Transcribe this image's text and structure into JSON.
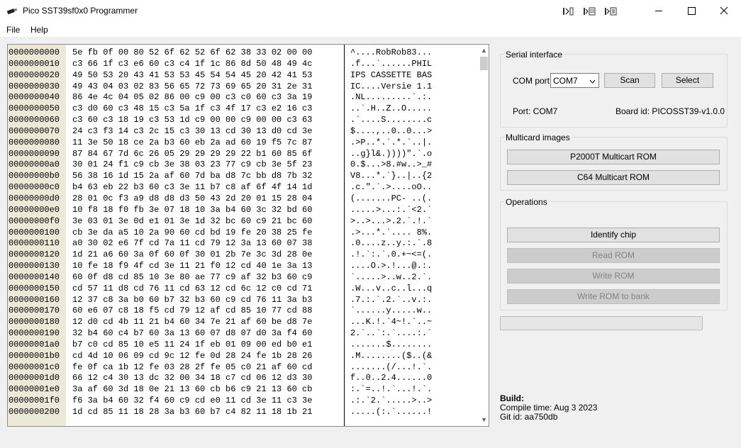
{
  "window": {
    "title": "Pico SST39sf0x0 Programmer",
    "app_icon": "usb-stick-icon",
    "toolbar_icons": [
      "dock-left-icon",
      "dock-image-icon",
      "dock-list-icon"
    ],
    "controls": {
      "minimize": "minimize-icon",
      "maximize": "maximize-icon",
      "close": "close-icon"
    }
  },
  "menu": {
    "file": "File",
    "help": "Help"
  },
  "hex": {
    "rows": [
      {
        "addr": "0000000000",
        "hex": "5e fb 0f 00 80 52 6f 62 52 6f 62 38 33 02 00 00",
        "ascii": "^....RobRob83..."
      },
      {
        "addr": "0000000010",
        "hex": "c3 66 1f c3 e6 60 c3 c4 1f 1c 86 8d 50 48 49 4c",
        "ascii": ".f...`......PHIL"
      },
      {
        "addr": "0000000020",
        "hex": "49 50 53 20 43 41 53 53 45 54 54 45 20 42 41 53",
        "ascii": "IPS CASSETTE BAS"
      },
      {
        "addr": "0000000030",
        "hex": "49 43 04 03 02 83 56 65 72 73 69 65 20 31 2e 31",
        "ascii": "IC....Versie 1.1"
      },
      {
        "addr": "0000000040",
        "hex": "86 4e 4c 04 05 02 86 00 c9 00 c3 c0 60 c3 3a 19",
        "ascii": ".NL.........`.:."
      },
      {
        "addr": "0000000050",
        "hex": "c3 d0 60 c3 48 15 c3 5a 1f c3 4f 17 c3 e2 16 c3",
        "ascii": "..`.H..Z..O....."
      },
      {
        "addr": "0000000060",
        "hex": "c3 60 c3 18 19 c3 53 1d c9 00 00 c9 00 00 c3 63",
        "ascii": ".`....S........c"
      },
      {
        "addr": "0000000070",
        "hex": "24 c3 f3 14 c3 2c 15 c3 30 13 cd 30 13 d0 cd 3e",
        "ascii": "$....,..0..0...>"
      },
      {
        "addr": "0000000080",
        "hex": "11 3e 50 18 ce 2a b3 60 eb 2a ad 60 19 f5 7c 87",
        "ascii": ".>P..*.`.*.`..|."
      },
      {
        "addr": "0000000090",
        "hex": "87 84 67 7d 6c 26 05 29 29 29 29 22 b1 60 85 6f",
        "ascii": "..g}l&.))))\".`.o"
      },
      {
        "addr": "00000000a0",
        "hex": "30 01 24 f1 c9 cb 3e 38 03 23 77 c9 cb 3e 5f 23",
        "ascii": "0.$...>8.#w..>_#"
      },
      {
        "addr": "00000000b0",
        "hex": "56 38 16 1d 15 2a af 60 7d ba d8 7c bb d8 7b 32",
        "ascii": "V8...*.`}..|..{2"
      },
      {
        "addr": "00000000c0",
        "hex": "b4 63 eb 22 b3 60 c3 3e 11 b7 c8 af 6f 4f 14 1d",
        "ascii": ".c.\".`.>....oO.."
      },
      {
        "addr": "00000000d0",
        "hex": "28 01 0c f3 a9 d8 d8 d3 50 43 2d 20 01 15 28 04",
        "ascii": "(.......PC- ..(."
      },
      {
        "addr": "00000000e0",
        "hex": "10 f8 18 f0 fb 3e 07 18 10 3a b4 60 3c 32 bd 60",
        "ascii": ".....>...:.`<2.`"
      },
      {
        "addr": "00000000f0",
        "hex": "3e 03 01 3e 0d e1 01 3e 1d 32 bc 60 c9 21 bc 60",
        "ascii": ">..>...>.2.`.!.`"
      },
      {
        "addr": "0000000100",
        "hex": "cb 3e da a5 10 2a 90 60 cd bd 19 fe 20 38 25 fe",
        "ascii": ".>...*.`.... 8%."
      },
      {
        "addr": "0000000110",
        "hex": "a0 30 02 e6 7f cd 7a 11 cd 79 12 3a 13 60 07 38",
        "ascii": ".0....z..y.:.`.8"
      },
      {
        "addr": "0000000120",
        "hex": "1d 21 a6 60 3a 0f 60 0f 30 01 2b 7e 3c 3d 28 0e",
        "ascii": ".!.`:.`.0.+~<=(."
      },
      {
        "addr": "0000000130",
        "hex": "10 fe 18 f9 4f cd 3e 11 21 f0 12 cd 40 1e 3a 13",
        "ascii": "....O.>.!...@.:."
      },
      {
        "addr": "0000000140",
        "hex": "60 0f d8 cd 85 10 3e 80 ae 77 c9 af 32 b3 60 c9",
        "ascii": "`.....>..w..2.`."
      },
      {
        "addr": "0000000150",
        "hex": "cd 57 11 d8 cd 76 11 cd 63 12 cd 6c 12 c0 cd 71",
        "ascii": ".W...v..c..l...q"
      },
      {
        "addr": "0000000160",
        "hex": "12 37 c8 3a b0 60 b7 32 b3 60 c9 cd 76 11 3a b3",
        "ascii": ".7.:.`.2.`..v.:."
      },
      {
        "addr": "0000000170",
        "hex": "60 e6 07 c8 18 f5 cd 79 12 af cd 85 10 77 cd 88",
        "ascii": "`......y.....w.."
      },
      {
        "addr": "0000000180",
        "hex": "12 d0 cd 4b 11 21 b4 60 34 7e 21 af 60 be d8 7e",
        "ascii": "...K.!.`4~!.`..~"
      },
      {
        "addr": "0000000190",
        "hex": "32 b4 60 c4 b7 60 3a 13 60 07 d8 07 d0 3a f4 60",
        "ascii": "2.`..`:.`....:.`"
      },
      {
        "addr": "00000001a0",
        "hex": "b7 c0 cd 85 10 e5 11 24 1f eb 01 09 00 ed b0 e1",
        "ascii": ".......$........"
      },
      {
        "addr": "00000001b0",
        "hex": "cd 4d 10 06 09 cd 9c 12 fe 0d 28 24 fe 1b 28 26",
        "ascii": ".M........($..(&"
      },
      {
        "addr": "00000001c0",
        "hex": "fe 0f ca 1b 12 fe 03 28 2f fe 05 c0 21 af 60 cd",
        "ascii": ".......(/...!.`."
      },
      {
        "addr": "00000001d0",
        "hex": "66 12 c4 30 13 dc 32 00 34 18 c7 cd 06 12 d3 30",
        "ascii": "f..0..2.4......0"
      },
      {
        "addr": "00000001e0",
        "hex": "3a af 60 3d 18 0e 21 13 60 cb b6 c9 21 13 60 cb",
        "ascii": ":.`=..!.`...!.`."
      },
      {
        "addr": "00000001f0",
        "hex": "f6 3a b4 60 32 f4 60 c9 cd e0 11 cd 3e 11 c3 3e",
        "ascii": ".:.`2.`.....>..>"
      },
      {
        "addr": "0000000200",
        "hex": "1d cd 85 11 18 28 3a b3 60 b7 c4 82 11 18 1b 21",
        "ascii": ".....(:.`......!"
      }
    ]
  },
  "serial": {
    "title": "Serial interface",
    "com_port_label": "COM port",
    "com_port_value": "COM7",
    "scan": "Scan",
    "select": "Select",
    "port_status": "Port: COM7",
    "board_id": "Board id: PICOSST39-v1.0.0"
  },
  "multicard": {
    "title": "Multicard images",
    "p2000t": "P2000T Multicart ROM",
    "c64": "C64 Multicart ROM"
  },
  "operations": {
    "title": "Operations",
    "identify": "Identify chip",
    "read": "Read ROM",
    "write": "Write ROM",
    "write_bank": "Write ROM to bank"
  },
  "progress": {
    "value": 0
  },
  "build": {
    "heading": "Build:",
    "compile": "Compile time: Aug 3 2023",
    "git": "Git id: aa750db"
  }
}
